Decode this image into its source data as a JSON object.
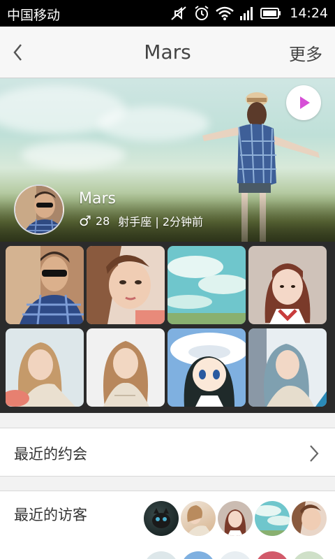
{
  "status_bar": {
    "carrier": "中国移动",
    "time": "14:24",
    "icons": [
      "mute-icon",
      "alarm-icon",
      "wifi-icon",
      "signal-icon",
      "battery-icon"
    ]
  },
  "nav": {
    "title": "Mars",
    "more_label": "更多",
    "back_icon": "chevron-left-icon"
  },
  "profile": {
    "name": "Mars",
    "gender_symbol": "♂",
    "age": "28",
    "details": "射手座 | 2分钟前",
    "play_icon": "play-icon"
  },
  "photos": [
    {
      "desc": "photo-1"
    },
    {
      "desc": "photo-2"
    },
    {
      "desc": "photo-3"
    },
    {
      "desc": "photo-4"
    },
    {
      "desc": "photo-5"
    },
    {
      "desc": "photo-6"
    },
    {
      "desc": "photo-7"
    },
    {
      "desc": "photo-8"
    }
  ],
  "recent_dates": {
    "label": "最近的约会",
    "chevron_icon": "chevron-right-icon"
  },
  "recent_visitors": {
    "label": "最近的访客"
  },
  "colors": {
    "accent": "#d64fd6",
    "navbar_bg": "#f7f7f7",
    "grid_bg": "#2b2b2b"
  }
}
